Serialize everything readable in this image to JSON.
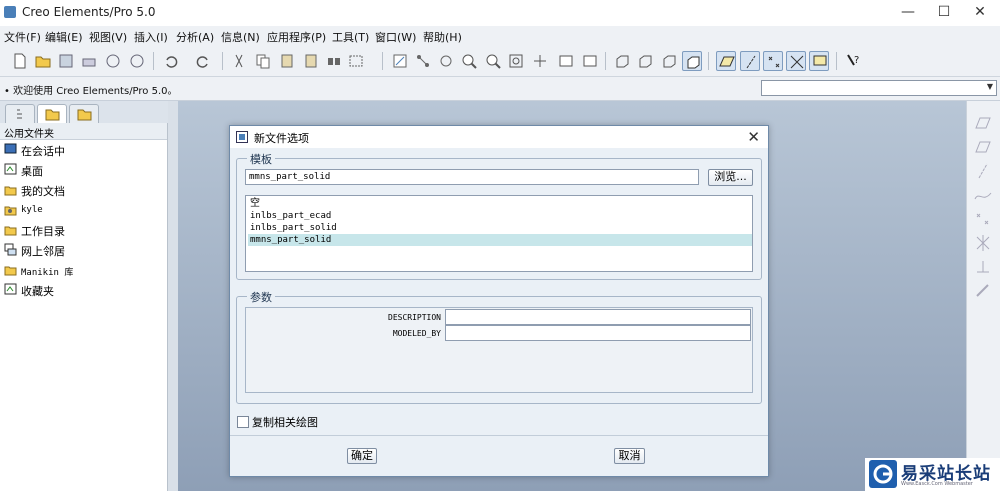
{
  "window": {
    "title": "Creo Elements/Pro 5.0",
    "minimize": "—",
    "maximize": "☐",
    "close": "✕"
  },
  "menu": [
    {
      "label": "文件(F)"
    },
    {
      "label": "编辑(E)"
    },
    {
      "label": "视图(V)"
    },
    {
      "label": "插入(I)"
    },
    {
      "label": "分析(A)"
    },
    {
      "label": "信息(N)"
    },
    {
      "label": "应用程序(P)"
    },
    {
      "label": "工具(T)"
    },
    {
      "label": "窗口(W)"
    },
    {
      "label": "帮助(H)"
    }
  ],
  "message": "• 欢迎使用 Creo Elements/Pro 5.0。",
  "navigator": {
    "header": "公用文件夹",
    "items": [
      {
        "label": "在会话中",
        "icon": "session-icon"
      },
      {
        "label": "桌面",
        "icon": "desktop-icon"
      },
      {
        "label": "我的文档",
        "icon": "my-documents-icon"
      },
      {
        "label": "kyle",
        "icon": "user-folder-icon"
      },
      {
        "label": "工作目录",
        "icon": "working-directory-icon"
      },
      {
        "label": "网上邻居",
        "icon": "network-icon"
      },
      {
        "label": "Manikin 库",
        "icon": "manikin-library-icon"
      },
      {
        "label": "收藏夹",
        "icon": "favorites-icon"
      }
    ]
  },
  "dialog": {
    "title": "新文件选项",
    "template_group": "模板",
    "template_value": "mmns_part_solid",
    "browse_label": "浏览...",
    "templates": [
      "空",
      "inlbs_part_ecad",
      "inlbs_part_solid",
      "mmns_part_solid"
    ],
    "selected_template_index": 3,
    "params_group": "参数",
    "params": [
      {
        "label": "DESCRIPTION",
        "value": ""
      },
      {
        "label": "MODELED_BY",
        "value": ""
      }
    ],
    "copy_drawing_label": "复制相关绘图",
    "copy_drawing_checked": false,
    "ok_label": "确定",
    "cancel_label": "取消"
  },
  "watermark": {
    "title": "易采站长站",
    "subtitle": "Www.Easck.Com Webmaster"
  },
  "colors": {
    "accent": "#1f5fae",
    "selected": "#c7e6ea",
    "graphics_top": "#b8c6d6",
    "graphics_bottom": "#8e9fb6"
  }
}
